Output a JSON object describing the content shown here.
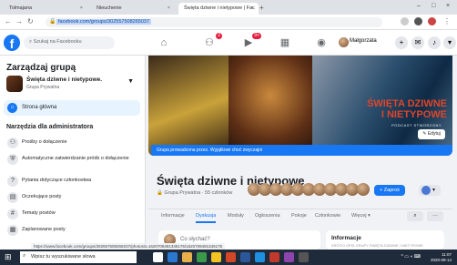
{
  "browser": {
    "tabs": [
      {
        "title": "Tolmajana"
      },
      {
        "title": "Nieuchenie"
      },
      {
        "title": "Święta dziwne i nietypowe | Fac"
      }
    ],
    "url": "facebook.com/groups/302557508265037"
  },
  "facebook": {
    "search_placeholder": "Szukaj na Facebooku",
    "badges": {
      "groups": "2",
      "watch": "9+"
    },
    "user_name": "Małgorzata"
  },
  "sidebar": {
    "title": "Zarządzaj grupą",
    "group_name": "Święta dziwne i nietypowe.",
    "group_type": "Grupa Prywatna",
    "home_label": "Strona główna",
    "admin_section": "Narzędzia dla administratora",
    "items": [
      {
        "label": "Prośby o dołączenie"
      },
      {
        "label": "Automatyczne zatwierdzanie próśb o dołączenie"
      },
      {
        "label": "Pytania dotyczące członkostwa"
      },
      {
        "label": "Oczekujące posty"
      },
      {
        "label": "Tematy postów"
      },
      {
        "label": "Zaplanowane posty"
      }
    ]
  },
  "cover": {
    "title_line1": "ŚWIĘTA DZIWNE",
    "title_line2": "I NIETYPOWE",
    "subtitle": "PODCAST STWORZONY",
    "edit_label": "Edytuj",
    "banner": "Grupa prowadzona przez. Wyjątkowi choć zwyczajni"
  },
  "group": {
    "title": "Święta dziwne i nietypowe",
    "meta": "Grupa Prywatna · 55 członków",
    "join_label": "+ Zaproś"
  },
  "tabs": [
    {
      "label": "Informacje"
    },
    {
      "label": "Dyskusja"
    },
    {
      "label": "Moduły"
    },
    {
      "label": "Ogłoszenia"
    },
    {
      "label": "Pokoje"
    },
    {
      "label": "Członkowie"
    },
    {
      "label": "Więcej ▾"
    }
  ],
  "composer_placeholder": "Co słychać?",
  "info_title": "Informacje",
  "info_sub": "KRÓTKI OPIS GRUPY ŚWIĘTA DZIWNE I NIETYPOWE",
  "status_url": "https://www.facebook.com/groups/302557508265037/photos/a.1620709491345175/1620709491345175",
  "taskbar": {
    "search_placeholder": "Wpisz tu wyszukiwane słowa",
    "time": "11:07",
    "date": "2020-09-14"
  }
}
